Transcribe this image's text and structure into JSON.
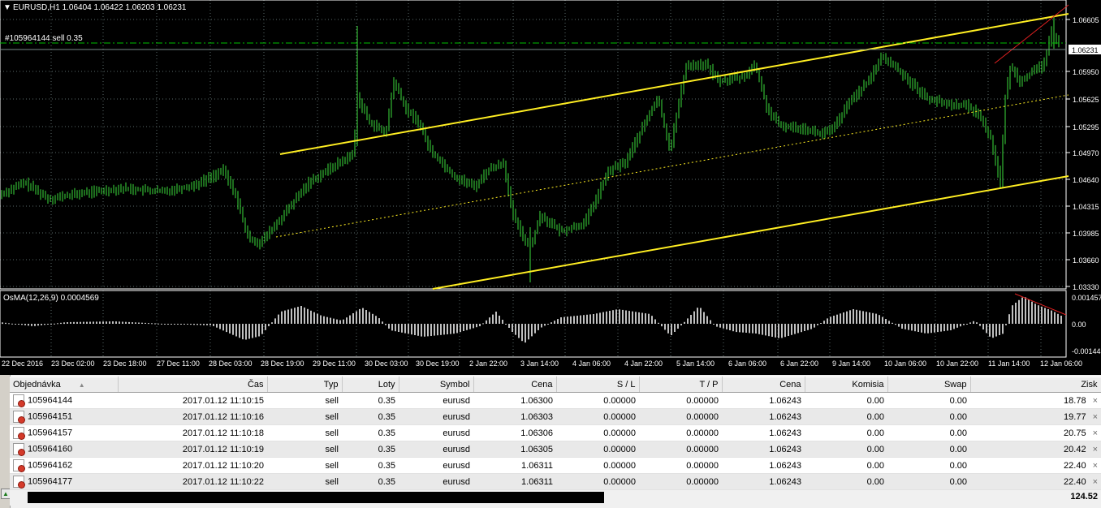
{
  "chart": {
    "title": "EURUSD,H1  1.06404 1.06422 1.06203 1.06231",
    "order_label": "#105964144 sell 0.35",
    "current_price": "1.06231",
    "price_ticks": [
      "1.06605",
      "1.05950",
      "1.05625",
      "1.05295",
      "1.04970",
      "1.04640",
      "1.04315",
      "1.03985",
      "1.03660",
      "1.03330"
    ],
    "osma_title": "OsMA(12,26,9) 0.0004569",
    "osma_ticks": [
      "0.001457",
      "0.00",
      "-0.00144"
    ],
    "time_ticks": [
      "22 Dec 2016",
      "23 Dec 02:00",
      "23 Dec 18:00",
      "27 Dec 11:00",
      "28 Dec 03:00",
      "28 Dec 19:00",
      "29 Dec 11:00",
      "30 Dec 03:00",
      "30 Dec 19:00",
      "2 Jan 22:00",
      "3 Jan 14:00",
      "4 Jan 06:00",
      "4 Jan 22:00",
      "5 Jan 14:00",
      "6 Jan 06:00",
      "6 Jan 22:00",
      "9 Jan 14:00",
      "10 Jan 06:00",
      "10 Jan 22:00",
      "11 Jan 14:00",
      "12 Jan 06:00"
    ],
    "colors": {
      "background": "#000000",
      "candles": "#3ddc3d",
      "grid": "#5a6a6a",
      "channel": "#ffee22",
      "trendline": "#e02020",
      "histogram": "#c0c0c0",
      "order_line": "#00c000"
    }
  },
  "terminal": {
    "columns": [
      "Objednávka",
      "Čas",
      "Typ",
      "Loty",
      "Symbol",
      "Cena",
      "S / L",
      "T / P",
      "Cena",
      "Komisia",
      "Swap",
      "Zisk"
    ],
    "sort_indicator": "▲",
    "rows": [
      [
        "105964144",
        "2017.01.12 11:10:15",
        "sell",
        "0.35",
        "eurusd",
        "1.06300",
        "0.00000",
        "0.00000",
        "1.06243",
        "0.00",
        "0.00",
        "18.78"
      ],
      [
        "105964151",
        "2017.01.12 11:10:16",
        "sell",
        "0.35",
        "eurusd",
        "1.06303",
        "0.00000",
        "0.00000",
        "1.06243",
        "0.00",
        "0.00",
        "19.77"
      ],
      [
        "105964157",
        "2017.01.12 11:10:18",
        "sell",
        "0.35",
        "eurusd",
        "1.06306",
        "0.00000",
        "0.00000",
        "1.06243",
        "0.00",
        "0.00",
        "20.75"
      ],
      [
        "105964160",
        "2017.01.12 11:10:19",
        "sell",
        "0.35",
        "eurusd",
        "1.06305",
        "0.00000",
        "0.00000",
        "1.06243",
        "0.00",
        "0.00",
        "20.42"
      ],
      [
        "105964162",
        "2017.01.12 11:10:20",
        "sell",
        "0.35",
        "eurusd",
        "1.06311",
        "0.00000",
        "0.00000",
        "1.06243",
        "0.00",
        "0.00",
        "22.40"
      ],
      [
        "105964177",
        "2017.01.12 11:10:22",
        "sell",
        "0.35",
        "eurusd",
        "1.06311",
        "0.00000",
        "0.00000",
        "1.06243",
        "0.00",
        "0.00",
        "22.40"
      ]
    ],
    "close_symbol": "×",
    "total_profit": "124.52",
    "add_icon": "up-arrow-icon"
  }
}
